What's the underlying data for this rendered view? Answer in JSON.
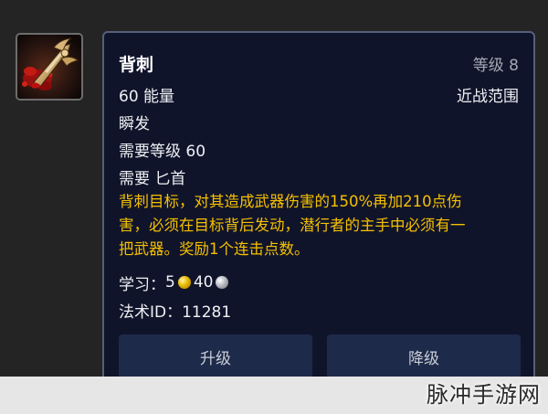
{
  "spell": {
    "name": "背刺",
    "rank": "等级 8",
    "cost": "60 能量",
    "range": "近战范围",
    "cast_time": "瞬发",
    "required_level": "需要等级 60",
    "required_weapon": "需要 匕首",
    "description_lines": [
      "背刺目标，对其造成武器伤害的150%再加210点伤",
      "害，必须在目标背后发动，潜行者的主手中必须有一",
      "把武器。奖励1个连击点数。"
    ],
    "learn_label": "学习：",
    "learn_gold": "5",
    "learn_silver": "40",
    "spell_id": "法术ID：11281"
  },
  "buttons": {
    "upgrade": "升级",
    "downgrade": "降级"
  },
  "watermark": "脉冲手游网",
  "colors": {
    "panel_bg": "#10142a",
    "panel_border": "#55607a",
    "description": "#f5c000",
    "button_bg": "#1e2a4a"
  },
  "icons": {
    "spell": "backstab-dagger-icon",
    "gold": "gold-coin-icon",
    "silver": "silver-coin-icon"
  }
}
